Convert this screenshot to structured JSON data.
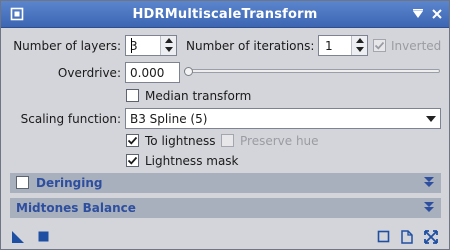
{
  "window": {
    "title": "HDRMultiscaleTransform"
  },
  "params": {
    "layers_label": "Number of layers:",
    "layers_value": "3",
    "iterations_label": "Number of iterations:",
    "iterations_value": "1",
    "inverted_label": "Inverted",
    "inverted_checked": true,
    "overdrive_label": "Overdrive:",
    "overdrive_value": "0.000",
    "overdrive_slider_fraction": 0.0,
    "median_label": "Median transform",
    "median_checked": false,
    "scaling_label": "Scaling function:",
    "scaling_value": "B3 Spline (5)",
    "to_lightness_label": "To lightness",
    "to_lightness_checked": true,
    "preserve_hue_label": "Preserve hue",
    "preserve_hue_checked": false,
    "lightness_mask_label": "Lightness mask",
    "lightness_mask_checked": true
  },
  "sections": {
    "deringing_label": "Deringing",
    "deringing_checked": false,
    "midtones_label": "Midtones Balance"
  },
  "colors": {
    "titlebar": "#4a74c0",
    "section_bg": "#a9b0bd",
    "section_text": "#2e4f9f",
    "icon_blue": "#1f4fa3"
  },
  "icons": {
    "titlebar": [
      "pin-icon",
      "close-icon"
    ],
    "bottom_left": [
      "new-instance-icon",
      "apply-global-icon"
    ],
    "bottom_right": [
      "browse-documentation-icon",
      "reset-icon",
      "expand-icon"
    ]
  }
}
